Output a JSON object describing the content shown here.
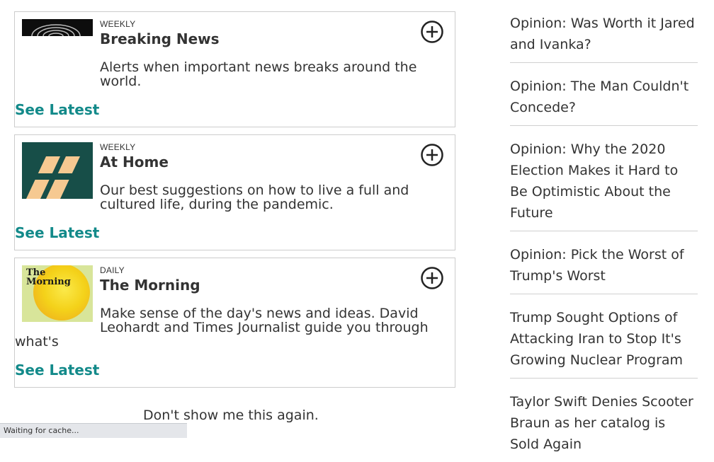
{
  "newsletters": [
    {
      "frequency": "WEEKLY",
      "title": "Breaking News",
      "description": "Alerts when important news breaks around the world.",
      "link": "See Latest",
      "thumbnail": "breaking-news-art"
    },
    {
      "frequency": "WEEKLY",
      "title": "At Home",
      "description": "Our best suggestions on how to live a full and cultured life, during the pandemic.",
      "link": "See Latest",
      "thumbnail": "at-home-logo"
    },
    {
      "frequency": "DAILY",
      "title": "The Morning",
      "description": "Make sense of the day's news and ideas. David Leohardt and Times Journalist guide you through what's",
      "link": "See Latest",
      "thumbnail": "the-morning-logo",
      "thumbnail_text": "The Morning"
    }
  ],
  "dont_show": "Don't show me this again.",
  "status_bar": "Waiting for cache...",
  "sidebar": {
    "items": [
      "Opinion: Was Worth it Jared and Ivanka?",
      "Opinion: The Man Couldn't Concede?",
      "Opinion: Why the 2020 Election Makes it Hard to Be Optimistic About the Future",
      "Opinion: Pick the Worst of Trump's Worst",
      "Trump Sought Options of Attacking Iran to Stop It's Growing Nuclear Program",
      "Taylor Swift Denies Scooter Braun as her catalog is Sold Again"
    ]
  },
  "colors": {
    "accent": "#138a8a",
    "at_home_bg": "#174e48",
    "at_home_stripes": "#f6c991",
    "morning_yellow": "#f4d21a"
  }
}
